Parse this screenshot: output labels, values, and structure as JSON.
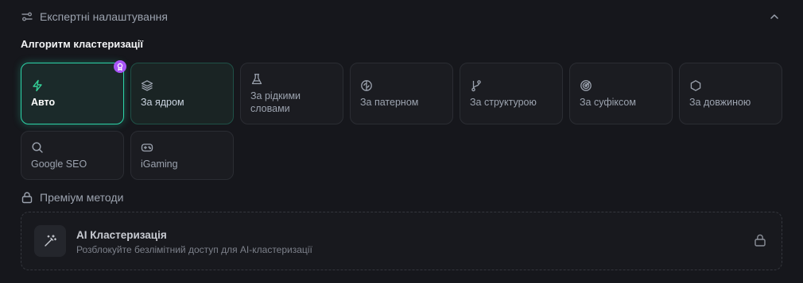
{
  "header": {
    "title": "Експертні налаштування",
    "icon": "sliders-icon",
    "toggle_icon": "chevron-up-icon"
  },
  "algorithm": {
    "title": "Алгоритм кластеризації",
    "options": [
      {
        "id": "auto",
        "label": "Авто",
        "icon": "zap-icon",
        "selected": true,
        "badge": "premium-award-icon"
      },
      {
        "id": "core",
        "label": "За ядром",
        "icon": "layers-icon",
        "selected": false
      },
      {
        "id": "rare",
        "label": "За рідкими словами",
        "icon": "flask-icon",
        "selected": false
      },
      {
        "id": "pattern",
        "label": "За патерном",
        "icon": "brain-icon",
        "selected": false
      },
      {
        "id": "structure",
        "label": "За структурою",
        "icon": "git-branch-icon",
        "selected": false
      },
      {
        "id": "suffix",
        "label": "За суфіксом",
        "icon": "target-icon",
        "selected": false
      },
      {
        "id": "length",
        "label": "За довжиною",
        "icon": "hexagon-icon",
        "selected": false
      },
      {
        "id": "google",
        "label": "Google SEO",
        "icon": "search-icon",
        "selected": false
      },
      {
        "id": "igaming",
        "label": "iGaming",
        "icon": "gamepad-icon",
        "selected": false
      }
    ]
  },
  "premium": {
    "title": "Преміум методи",
    "item": {
      "title": "AI Кластеризація",
      "subtitle": "Розблокуйте безлімітний доступ для AI-кластеризації",
      "icon": "magic-wand-icon",
      "lock_icon": "lock-icon"
    }
  },
  "colors": {
    "background": "#16171c",
    "accent": "#2dd4a8",
    "badge": "#a855f7"
  }
}
